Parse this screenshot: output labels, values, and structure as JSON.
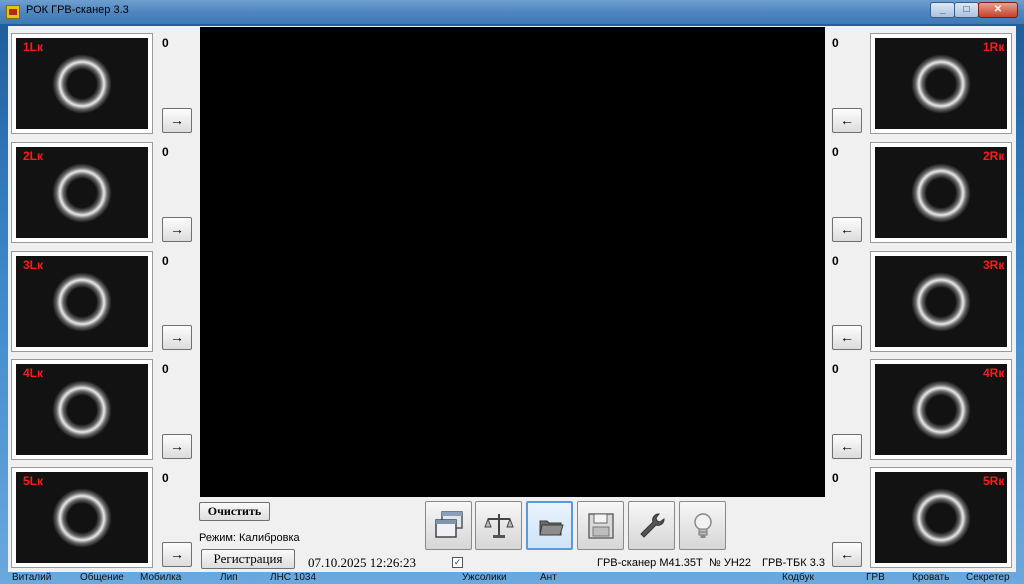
{
  "window": {
    "title": "РОК ГРВ-сканер 3.3"
  },
  "left_thumbs": [
    {
      "label": "1Lк",
      "value": "0"
    },
    {
      "label": "2Lк",
      "value": "0"
    },
    {
      "label": "3Lк",
      "value": "0"
    },
    {
      "label": "4Lк",
      "value": "0"
    },
    {
      "label": "5Lк",
      "value": "0"
    }
  ],
  "right_thumbs": [
    {
      "label": "1Rк",
      "value": "0"
    },
    {
      "label": "2Rк",
      "value": "0"
    },
    {
      "label": "3Rк",
      "value": "0"
    },
    {
      "label": "4Rк",
      "value": "0"
    },
    {
      "label": "5Rк",
      "value": "0"
    }
  ],
  "icons": {
    "arrow_right": "→",
    "arrow_left": "←",
    "check": "✓"
  },
  "controls": {
    "clear_label": "Очистить",
    "mode_text": "Режим: Калибровка",
    "register_label": "Регистрация",
    "datetime": "07.10.2025 12:26:23"
  },
  "toolbar": [
    {
      "name": "windows-icon"
    },
    {
      "name": "scales-icon"
    },
    {
      "name": "folder-icon"
    },
    {
      "name": "save-icon"
    },
    {
      "name": "wrench-icon"
    },
    {
      "name": "lightbulb-icon"
    }
  ],
  "status": {
    "device": "ГРВ-сканер М41.35Т",
    "number": "№ УН22",
    "version": "ГРВ-ТБК 3.3"
  },
  "taskbar": [
    "Виталий",
    "Общение",
    "Мобилка",
    "Лип",
    "ЛНС 1034",
    "Ужсолики",
    "Ант",
    "Кодбук",
    "ГРВ",
    "Кровать",
    "Секретер"
  ],
  "colors": {
    "thumb_label": "#ff1a1a",
    "viewer_bg": "#000000"
  }
}
